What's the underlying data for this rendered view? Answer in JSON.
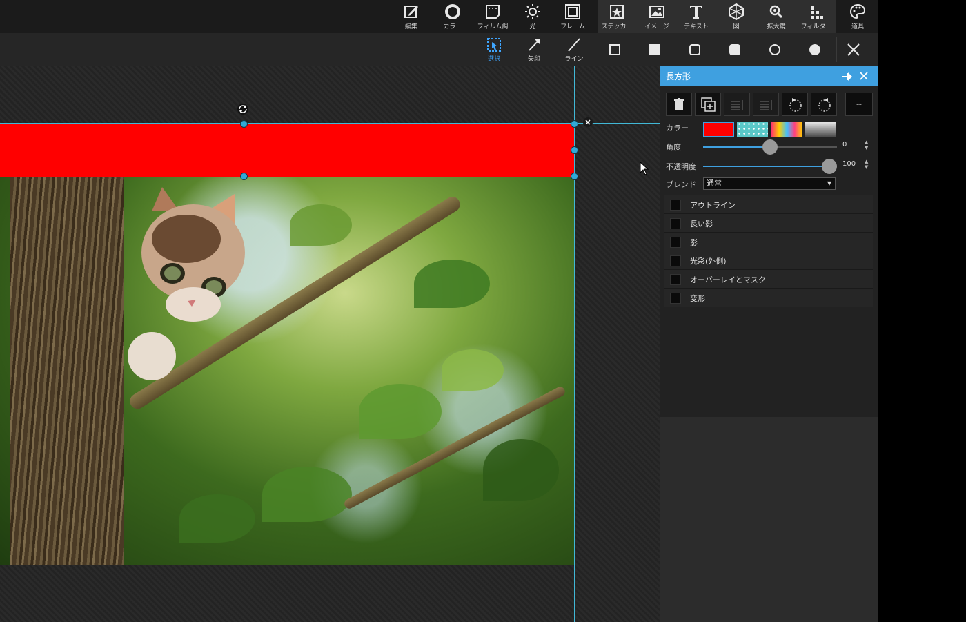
{
  "toolbar": {
    "items": [
      {
        "label": "編集",
        "icon": "edit-icon"
      },
      {
        "label": "カラー",
        "icon": "color-icon"
      },
      {
        "label": "フィルム調",
        "icon": "film-icon"
      },
      {
        "label": "光",
        "icon": "light-icon"
      },
      {
        "label": "フレーム",
        "icon": "frame-icon"
      },
      {
        "label": "ステッカー",
        "icon": "sticker-icon"
      },
      {
        "label": "イメージ",
        "icon": "image-icon"
      },
      {
        "label": "テキスト",
        "icon": "text-icon"
      },
      {
        "label": "図",
        "icon": "shape-icon"
      },
      {
        "label": "拡大鏡",
        "icon": "magnifier-icon"
      },
      {
        "label": "フィルター",
        "icon": "filter-icon"
      },
      {
        "label": "道具",
        "icon": "tools-icon"
      }
    ]
  },
  "subtoolbar": {
    "select_label": "選択",
    "arrow_label": "矢印",
    "line_label": "ライン",
    "active": "選択"
  },
  "panel": {
    "title": "長方形",
    "more_label": "...",
    "color_label": "カラー",
    "angle_label": "角度",
    "angle_value": "0",
    "opacity_label": "不透明度",
    "opacity_value": "100",
    "blend_label": "ブレンド",
    "blend_value": "通常",
    "options": [
      "アウトライン",
      "長い影",
      "影",
      "光彩(外側)",
      "オーバーレイとマスク",
      "変形"
    ]
  },
  "colors": {
    "accent": "#3fa0e0",
    "shape_fill": "#ff0000",
    "guide": "#41b8d6"
  }
}
